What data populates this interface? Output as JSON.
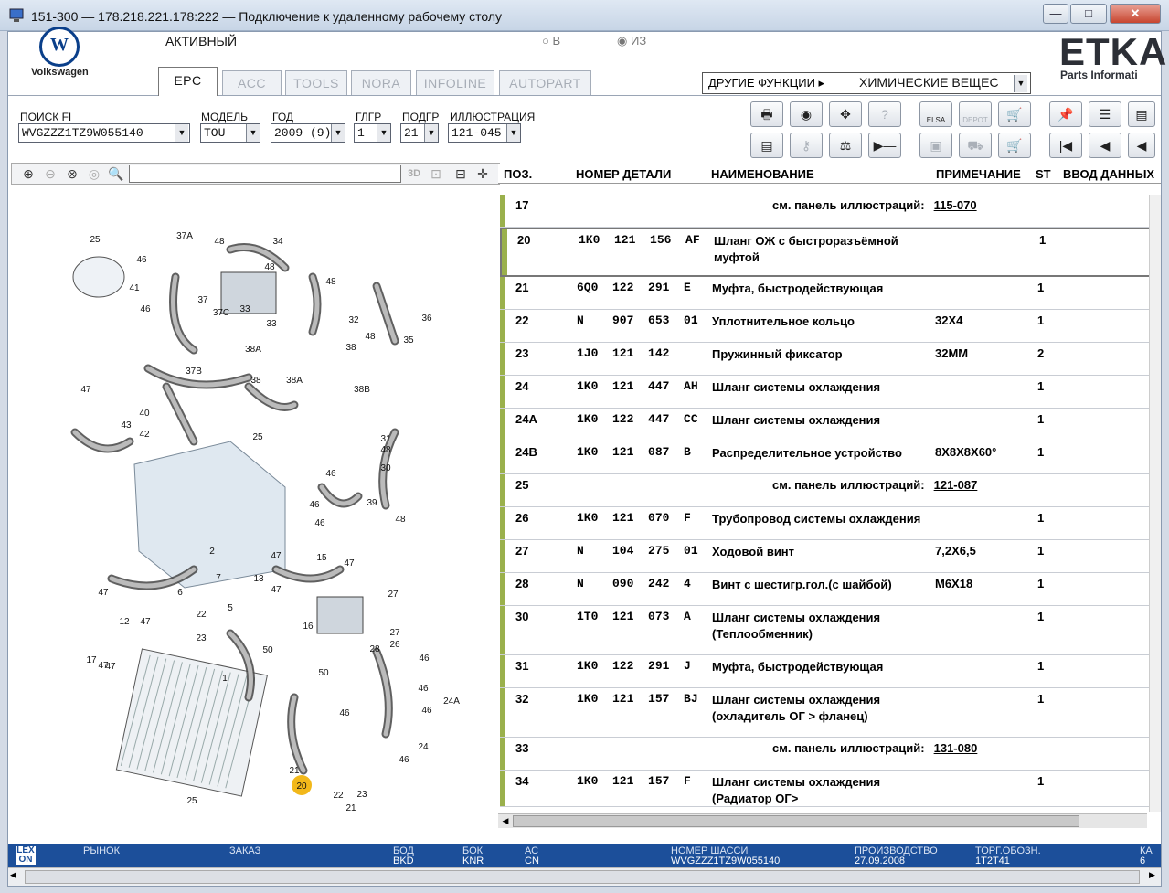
{
  "window": {
    "title": "151-300 — 178.218.221.178:222 — Подключение к удаленному рабочему столу",
    "min": "—",
    "max": "□",
    "close": "✕"
  },
  "header": {
    "brand": "Volkswagen",
    "status": "АКТИВНЫЙ",
    "radio_in": "В",
    "radio_out": "ИЗ",
    "logo_title": "ETKA",
    "logo_sub": "Parts Informati",
    "other_functions": "ДРУГИЕ ФУНКЦИИ ▸",
    "other_functions_value": "ХИМИЧЕСКИЕ ВЕЩЕС",
    "tabs": [
      "EPC",
      "ACC",
      "TOOLS",
      "NORA",
      "INFOLINE",
      "AUTOPART"
    ]
  },
  "filters": {
    "fi_label": "ПОИСК FI",
    "fi_value": "WVGZZZ1TZ9W055140",
    "model_label": "МОДЕЛЬ",
    "model_value": "TOU",
    "year_label": "ГОД",
    "year_value": "2009 (9)",
    "mg_label": "ГЛГР",
    "mg_value": "1",
    "sg_label": "ПОДГР",
    "sg_value": "21",
    "ill_label": "ИЛЛЮСТРАЦИЯ",
    "ill_value": "121-045"
  },
  "toolbar": {
    "elsa": "ELSA",
    "depot": "DEPOT"
  },
  "grid": {
    "columns": [
      "ПОЗ.",
      "НОМЕР ДЕТАЛИ",
      "НАИМЕНОВАНИЕ",
      "ПРИМЕЧАНИЕ",
      "ST",
      "ВВОД ДАННЫХ"
    ],
    "ref_prefix": "см. панель иллюстраций:",
    "rows": [
      {
        "pos": "17",
        "ref": "115-070"
      },
      {
        "pos": "20",
        "pn": "1K0  121  156  AF",
        "name": "Шланг ОЖ с быстроразъёмной муфтой",
        "note": "",
        "st": "1"
      },
      {
        "pos": "21",
        "pn": "6Q0  122  291  E",
        "name": "Муфта, быстродействующая",
        "note": "",
        "st": "1"
      },
      {
        "pos": "22",
        "pn": "N    907  653  01",
        "name": "Уплотнительное кольцо",
        "note": "32X4",
        "st": "1"
      },
      {
        "pos": "23",
        "pn": "1J0  121  142",
        "name": "Пружинный фиксатор",
        "note": "32MM",
        "st": "2"
      },
      {
        "pos": "24",
        "pn": "1K0  121  447  AH",
        "name": "Шланг системы охлаждения",
        "note": "",
        "st": "1"
      },
      {
        "pos": "24A",
        "pn": "1K0  122  447  CC",
        "name": "Шланг системы охлаждения",
        "note": "",
        "st": "1"
      },
      {
        "pos": "24B",
        "pn": "1K0  121  087  B",
        "name": "Распределительное устройство",
        "note": "8X8X8X60°",
        "st": "1"
      },
      {
        "pos": "25",
        "ref": "121-087"
      },
      {
        "pos": "26",
        "pn": "1K0  121  070  F",
        "name": "Трубопровод системы охлаждения",
        "note": "",
        "st": "1"
      },
      {
        "pos": "27",
        "pn": "N    104  275  01",
        "name": "Ходовой винт",
        "note": "7,2X6,5",
        "st": "1"
      },
      {
        "pos": "28",
        "pn": "N    090  242  4",
        "name": "Винт с шестигр.гол.(с шайбой)",
        "note": "M6X18",
        "st": "1"
      },
      {
        "pos": "30",
        "pn": "1T0  121  073  A",
        "name": "Шланг системы охлаждения (Теплообменник)",
        "note": "",
        "st": "1"
      },
      {
        "pos": "31",
        "pn": "1K0  122  291  J",
        "name": "Муфта, быстродействующая",
        "note": "",
        "st": "1"
      },
      {
        "pos": "32",
        "pn": "1K0  121  157  BJ",
        "name": "Шланг системы охлаждения (охладитель ОГ > фланец)",
        "note": "",
        "st": "1"
      },
      {
        "pos": "33",
        "ref": "131-080"
      },
      {
        "pos": "34",
        "pn": "1K0  121  157  F",
        "name": "Шланг системы охлаждения (Радиатор ОГ>",
        "note": "",
        "st": "1"
      }
    ]
  },
  "diagram": {
    "labels": [
      "25",
      "37A",
      "48",
      "34",
      "46",
      "41",
      "48",
      "48",
      "37",
      "46",
      "36",
      "33",
      "37C",
      "33",
      "32",
      "38A",
      "48",
      "35",
      "38",
      "38",
      "37B",
      "38A",
      "38B",
      "47",
      "43",
      "42",
      "40",
      "25",
      "31",
      "48",
      "30",
      "46",
      "46",
      "39",
      "46",
      "48",
      "47",
      "15",
      "47",
      "6",
      "13",
      "47",
      "16",
      "27",
      "46",
      "28",
      "26",
      "27",
      "12",
      "47",
      "22",
      "23",
      "5",
      "50",
      "17",
      "47",
      "46",
      "1",
      "50",
      "46",
      "24A",
      "46",
      "24",
      "46",
      "21",
      "20",
      "22",
      "23",
      "21",
      "25",
      "47",
      "47",
      "7",
      "2"
    ],
    "highlight": "20"
  },
  "footer": {
    "lex": "LEX",
    "lex2": "ON",
    "labels": [
      "РЫНОК",
      "ЗАКАЗ",
      "БОД",
      "БОК",
      "АС",
      "НОМЕР ШАССИ",
      "ПРОИЗВОДСТВО",
      "ТОРГ.ОБОЗН.",
      "КА"
    ],
    "values": [
      "",
      "",
      "BKD",
      "KNR",
      "CN",
      "WVGZZZ1TZ9W055140",
      "27.09.2008",
      "1T2T41",
      "6"
    ]
  },
  "colors": {
    "title_bar": "#cfdcec",
    "footer": "#1c4f9a",
    "row_marker": "#9ab04c",
    "highlight": "#f2b81a"
  }
}
